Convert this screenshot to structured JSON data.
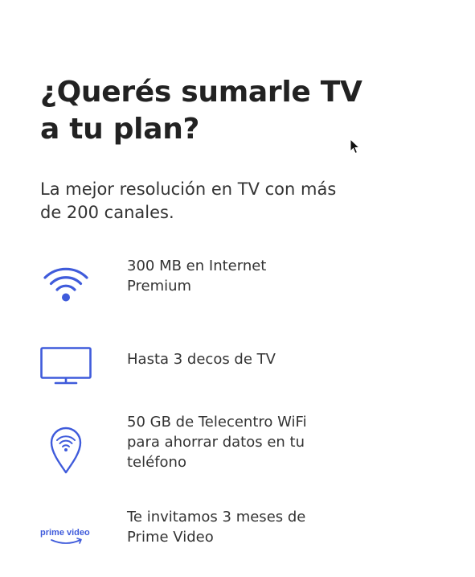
{
  "title_line1": "¿Querés sumarle TV",
  "title_line2": "a tu plan?",
  "subtitle_line1": "La mejor resolución en TV con más",
  "subtitle_line2": "de 200 canales.",
  "colors": {
    "accent": "#3f5bdb",
    "text": "#333333",
    "title": "#222222"
  },
  "features": [
    {
      "icon": "wifi-icon",
      "line1": "300 MB en Internet",
      "line2": "Premium"
    },
    {
      "icon": "tv-icon",
      "line1": "Hasta 3 decos de TV"
    },
    {
      "icon": "wifi-location-pin-icon",
      "line1": "50 GB de Telecentro WiFi",
      "line2": "para ahorrar datos en tu",
      "line3": "teléfono"
    },
    {
      "icon": "prime-video-logo",
      "logo_text": "prime video",
      "line1": "Te invitamos 3 meses de",
      "line2": "Prime Video"
    }
  ]
}
